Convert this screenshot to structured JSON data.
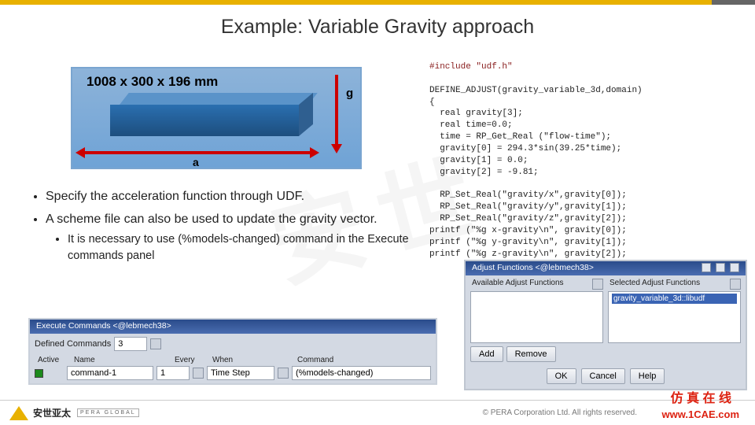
{
  "title": "Example: Variable Gravity approach",
  "diagram": {
    "dimensions": "1008 x 300 x 196 mm",
    "label_a": "a",
    "label_g": "g"
  },
  "bullets": {
    "b1": "Specify the acceleration function through UDF.",
    "b2": "A scheme file can also be used to update the gravity vector.",
    "b2a": "It is necessary to use (%models-changed) command in the Execute commands panel"
  },
  "code": {
    "line1": "#include \"udf.h\"",
    "line2": "DEFINE_ADJUST(gravity_variable_3d,domain)",
    "line3": "{",
    "line4": "  real gravity[3];",
    "line5": "  real time=0.0;",
    "line6": "  time = RP_Get_Real (\"flow-time\");",
    "line7": "  gravity[0] = 294.3*sin(39.25*time);",
    "line8": "  gravity[1] = 0.0;",
    "line9": "  gravity[2] = -9.81;",
    "line10": "",
    "line11": "  RP_Set_Real(\"gravity/x\",gravity[0]);",
    "line12": "  RP_Set_Real(\"gravity/y\",gravity[1]);",
    "line13": "  RP_Set_Real(\"gravity/z\",gravity[2]);",
    "line14": "printf (\"%g x-gravity\\n\", gravity[0]);",
    "line15": "printf (\"%g y-gravity\\n\", gravity[1]);",
    "line16": "printf (\"%g z-gravity\\n\", gravity[2]);"
  },
  "exec": {
    "title": "Execute Commands  <@lebmech38>",
    "defined": "Defined Commands",
    "defined_val": "3",
    "h_active": "Active",
    "h_name": "Name",
    "h_every": "Every",
    "h_when": "When",
    "h_command": "Command",
    "row_name": "command-1",
    "row_every": "1",
    "row_when": "Time Step",
    "row_cmd": "(%models-changed)"
  },
  "adj": {
    "title": "Adjust Functions  <@lebmech38>",
    "avail": "Available Adjust Functions",
    "sel": "Selected Adjust Functions",
    "item": "gravity_variable_3d::libudf",
    "add": "Add",
    "remove": "Remove",
    "ok": "OK",
    "cancel": "Cancel",
    "help": "Help"
  },
  "footer": {
    "brand": "安世亚太",
    "brand_sub": "PERA GLOBAL",
    "copy": "©   PERA Corporation Ltd. All rights reserved.",
    "link1": "仿 真 在 线",
    "link2": "www.1CAE.com"
  },
  "watermark": "安世"
}
